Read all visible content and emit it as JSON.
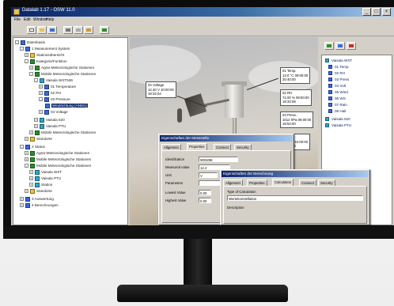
{
  "app": {
    "title": "Datalab 1.17 - OSW 11.0",
    "menu": [
      "File",
      "Edit",
      "Window",
      "Help"
    ]
  },
  "tree": {
    "nodes": [
      "Datenbasis",
      "1 Measurement System",
      "Stationsübersicht",
      "Kategorie/Funktion",
      "Agrar-Meteorologische Stationen",
      "Mobile Meteorologische Stationen",
      "Vaisala WXT536",
      "01 Temperature",
      "02 RH",
      "03 Pressure",
      "Windrichtung (ANM1)",
      "04 Voltage",
      "Vaisala 520",
      "Vaisala PTU",
      "Mobile Meteorologische Stationen",
      "Standorte",
      "2 Status",
      "Agrar-Meteorologische Stationen",
      "Mobile Meteorologische Stationen",
      "Mobile Meteorologische Stationen",
      "Vaisala WXT",
      "Vaisala PTU",
      "Station",
      "Standorte",
      "3 Auswertung",
      "4 Berechnungen"
    ]
  },
  "photo": {
    "labels": [
      "04 Voltage\n12.40 V 10:00:00\n19:32:04",
      "01 Temp.\n13.0 °C 09:00:00\n20:40:00",
      "02 RH\n72.00 % 09:00:00\n18:32:08",
      "03 Press.\n1012 hPa 09:00:00\n18:54:00",
      "Wind\n1.2 m/s 10:00:00\n18:32:04"
    ]
  },
  "right_list": {
    "items": [
      "Vaisala WXT",
      "01 Temp",
      "02 RH",
      "03 Press",
      "04 Volt",
      "05 Wind",
      "06 WS",
      "07 Rain",
      "08 Hail",
      "Vaisala 520",
      "Vaisala PTU"
    ]
  },
  "dialog_properties": {
    "title": "Eigenschaften der Messstelle",
    "tabs": [
      "Allgemein",
      "Properties",
      "Connect",
      "Security"
    ],
    "fields": [
      {
        "label": "Identification",
        "value": "M03258"
      },
      {
        "label": "Measured value",
        "value": "12.4"
      },
      {
        "label": "Unit",
        "value": "V"
      },
      {
        "label": "Parameters",
        "value": ""
      },
      {
        "label": "Lowest Value",
        "value": "0.00"
      },
      {
        "label": "Highest Value",
        "value": "0.00"
      }
    ]
  },
  "dialog_calc": {
    "title": "Eigenschaften der Berechnung",
    "tabs": [
      "Allgemein",
      "Properties",
      "Calculation",
      "Connect",
      "Security"
    ],
    "type_label": "Type of Calculation",
    "type_value": "Wertekonstellation",
    "desc_label": "Description"
  },
  "colors": {
    "title_start": "#0a246a",
    "title_end": "#a6caf0",
    "chrome": "#d4d0c8",
    "selection": "#0a246a"
  }
}
